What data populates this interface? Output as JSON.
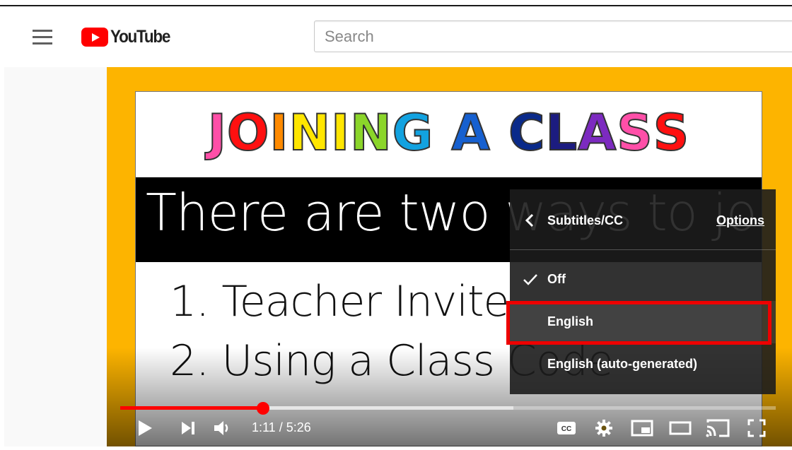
{
  "header": {
    "logo_text": "YouTube",
    "search_placeholder": "Search"
  },
  "video": {
    "title_letters": [
      {
        "ch": "J",
        "color": "#ff4fa8"
      },
      {
        "ch": "O",
        "color": "#ff1010"
      },
      {
        "ch": "I",
        "color": "#ff8a00"
      },
      {
        "ch": "N",
        "color": "#ffe600"
      },
      {
        "ch": "I",
        "color": "#ffe600"
      },
      {
        "ch": "N",
        "color": "#8bd52a"
      },
      {
        "ch": "G",
        "color": "#12a2e0"
      },
      {
        "ch": " ",
        "color": "#000000"
      },
      {
        "ch": "A",
        "color": "#1660d0"
      },
      {
        "ch": " ",
        "color": "#000000"
      },
      {
        "ch": "C",
        "color": "#0a2a8a"
      },
      {
        "ch": "L",
        "color": "#1c1c80"
      },
      {
        "ch": "A",
        "color": "#7c2ac0"
      },
      {
        "ch": "S",
        "color": "#ff4fa8"
      },
      {
        "ch": "S",
        "color": "#ff1010"
      }
    ],
    "band_text": "There are two ways to join:",
    "item1": "1.  Teacher Invite",
    "item2": "2. Using a Class Code"
  },
  "menu": {
    "title": "Subtitles/CC",
    "options_label": "Options",
    "items": [
      {
        "label": "Off",
        "checked": true
      },
      {
        "label": "English",
        "checked": false
      },
      {
        "label": "English (auto-generated)",
        "checked": false
      }
    ]
  },
  "player": {
    "time_display": "1:11 / 5:26",
    "played_fraction": 0.218,
    "buffered_fraction": 0.6
  },
  "colors": {
    "player_background": "#fdb400",
    "accent": "#ff0000",
    "highlight_box": "#ee0000"
  }
}
